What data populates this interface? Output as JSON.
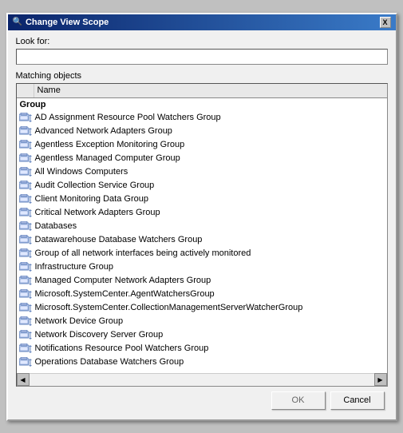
{
  "dialog": {
    "title": "Change View Scope",
    "close_label": "X"
  },
  "look_for": {
    "label": "Look for:",
    "value": "",
    "placeholder": ""
  },
  "matching_objects": {
    "label": "Matching objects",
    "column_name": "Name",
    "group_header": "Group",
    "items": [
      "AD Assignment Resource Pool Watchers Group",
      "Advanced Network Adapters Group",
      "Agentless Exception Monitoring Group",
      "Agentless Managed Computer Group",
      "All Windows Computers",
      "Audit Collection Service Group",
      "Client Monitoring Data Group",
      "Critical Network Adapters Group",
      "Databases",
      "Datawarehouse Database Watchers Group",
      "Group of all network interfaces being actively monitored",
      "Infrastructure Group",
      "Managed Computer Network Adapters Group",
      "Microsoft.SystemCenter.AgentWatchersGroup",
      "Microsoft.SystemCenter.CollectionManagementServerWatcherGroup",
      "Network Device Group",
      "Network Discovery Server Group",
      "Notifications Resource Pool Watchers Group",
      "Operations Database Watchers Group"
    ]
  },
  "buttons": {
    "ok_label": "OK",
    "cancel_label": "Cancel"
  }
}
